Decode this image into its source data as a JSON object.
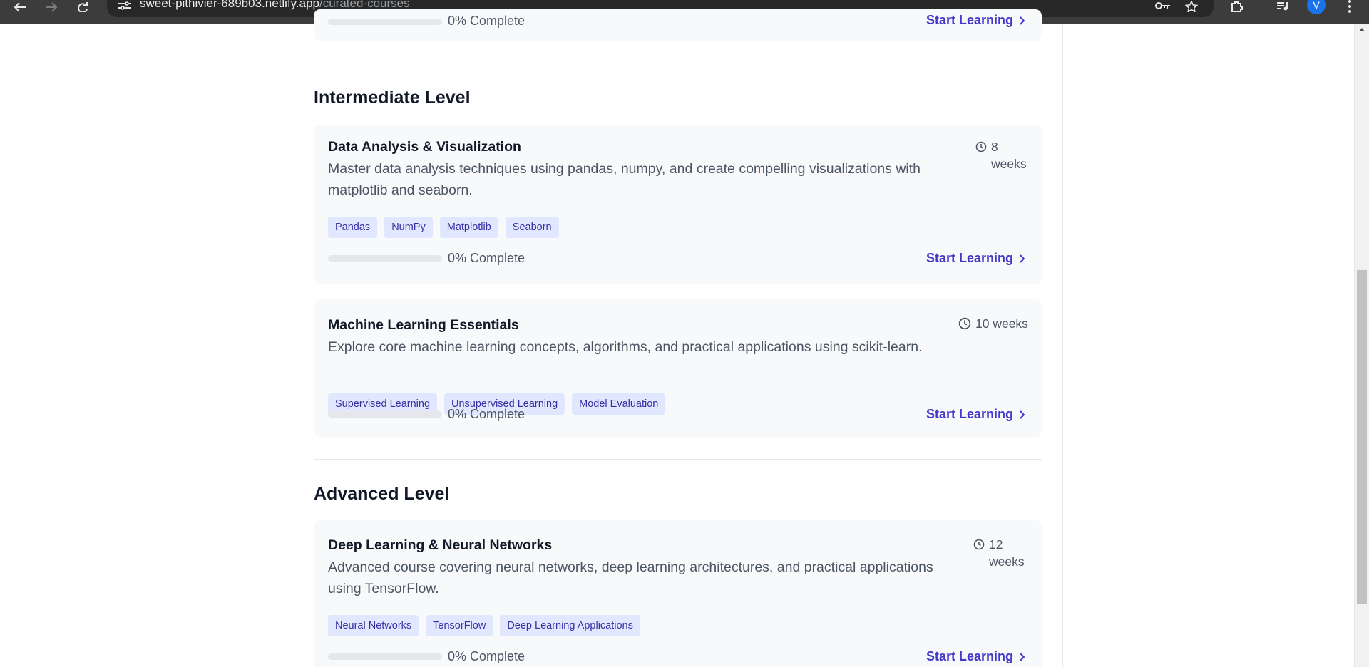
{
  "browser": {
    "url_host": "sweet-pithivier-689b03.netlify.app",
    "url_path": "/curated-courses",
    "profile_initial": "V"
  },
  "top_card": {
    "progress_text": "0% Complete",
    "start_label": "Start Learning"
  },
  "sections": [
    {
      "title": "Intermediate Level",
      "courses": [
        {
          "title": "Data Analysis & Visualization",
          "description": "Master data analysis techniques using pandas, numpy, and create compelling visualizations with matplotlib and seaborn.",
          "duration_num": "8",
          "duration_unit": "weeks",
          "tags": [
            "Pandas",
            "NumPy",
            "Matplotlib",
            "Seaborn"
          ],
          "progress_percent": 0,
          "progress_text": "0% Complete",
          "start_label": "Start Learning"
        },
        {
          "title": "Machine Learning Essentials",
          "description": "Explore core machine learning concepts, algorithms, and practical applications using scikit-learn.",
          "duration": "10 weeks",
          "tags": [
            "Supervised Learning",
            "Unsupervised Learning",
            "Model Evaluation"
          ],
          "progress_percent": 0,
          "progress_text": "0% Complete",
          "start_label": "Start Learning"
        }
      ]
    },
    {
      "title": "Advanced Level",
      "courses": [
        {
          "title": "Deep Learning & Neural Networks",
          "description": "Advanced course covering neural networks, deep learning architectures, and practical applications using TensorFlow.",
          "duration_num": "12",
          "duration_unit": "weeks",
          "tags": [
            "Neural Networks",
            "TensorFlow",
            "Deep Learning Applications"
          ],
          "progress_percent": 0,
          "progress_text": "0% Complete",
          "start_label": "Start Learning"
        }
      ]
    }
  ],
  "icons": {
    "back": "arrow-left-icon",
    "forward": "arrow-right-icon",
    "reload": "reload-icon",
    "site_info": "tune-icon",
    "password": "key-icon",
    "bookmark": "star-icon",
    "extensions": "puzzle-icon",
    "media": "music-icon",
    "menu": "kebab-icon",
    "duration": "clock-icon",
    "start": "chevron-right-icon"
  },
  "colors": {
    "accent": "#4338ca",
    "tag_bg": "#e0e7ff",
    "tag_text": "#3730a3",
    "card_bg": "#f8f9fb"
  }
}
